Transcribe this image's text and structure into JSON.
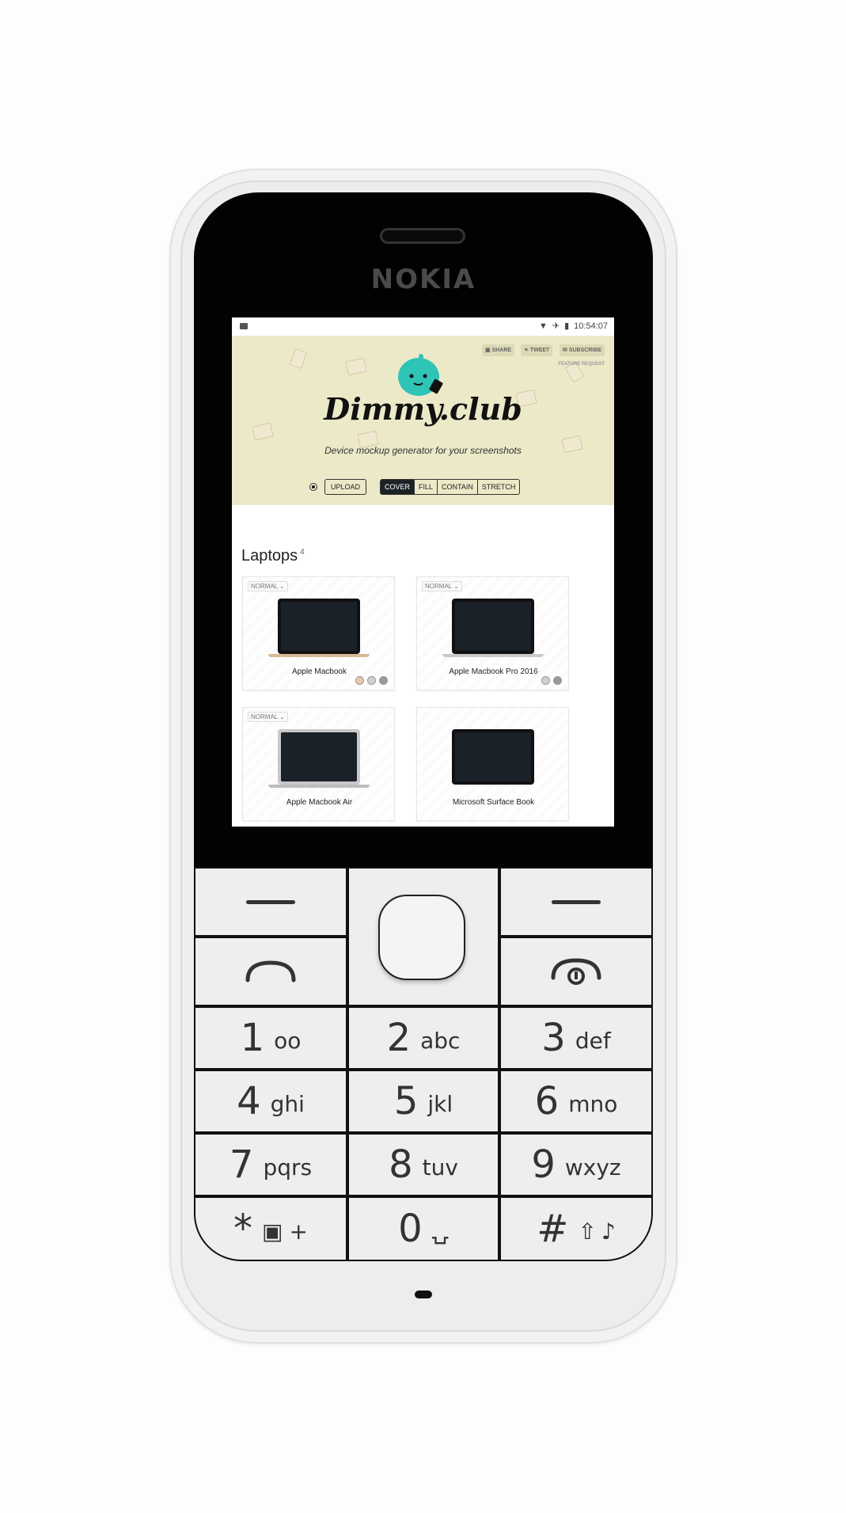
{
  "device": {
    "brand": "NOKIA"
  },
  "status_bar": {
    "time": "10:54:07",
    "icons": [
      "image-icon",
      "wifi-icon",
      "airplane-icon",
      "battery-icon"
    ]
  },
  "site": {
    "logo": "Dimmy.club",
    "tagline": "Device mockup generator for your screenshots",
    "share_label": "SHARE",
    "tweet_label": "TWEET",
    "subscribe_label": "SUBSCRIBE",
    "feature_request_label": "FEATURE REQUEST",
    "upload_label": "UPLOAD",
    "fit_options": [
      "COVER",
      "FILL",
      "CONTAIN",
      "STRETCH"
    ],
    "fit_selected": "COVER",
    "accent": "#ebe9c8",
    "mascot_color": "#2ec4b6"
  },
  "laptops": {
    "title": "Laptops",
    "count": "4",
    "items": [
      {
        "name": "Apple Macbook",
        "badge": "NORMAL ⌄",
        "swatches": [
          "#e8c9a8",
          "#d0d0d0",
          "#9a9a9a"
        ]
      },
      {
        "name": "Apple Macbook Pro 2016",
        "badge": "NORMAL ⌄",
        "swatches": [
          "#d0d0d0",
          "#9a9a9a"
        ]
      },
      {
        "name": "Apple Macbook Air",
        "badge": "NORMAL ⌄",
        "swatches": []
      },
      {
        "name": "Microsoft Surface Book",
        "badge": "",
        "swatches": []
      }
    ]
  },
  "keypad": {
    "keys": [
      {
        "num": "1",
        "letters": "oo"
      },
      {
        "num": "2",
        "letters": "abc"
      },
      {
        "num": "3",
        "letters": "def"
      },
      {
        "num": "4",
        "letters": "ghi"
      },
      {
        "num": "5",
        "letters": "jkl"
      },
      {
        "num": "6",
        "letters": "mno"
      },
      {
        "num": "7",
        "letters": "pqrs"
      },
      {
        "num": "8",
        "letters": "tuv"
      },
      {
        "num": "9",
        "letters": "wxyz"
      },
      {
        "num": "*",
        "letters": "+"
      },
      {
        "num": "0",
        "letters": ""
      },
      {
        "num": "#",
        "letters": ""
      }
    ]
  }
}
